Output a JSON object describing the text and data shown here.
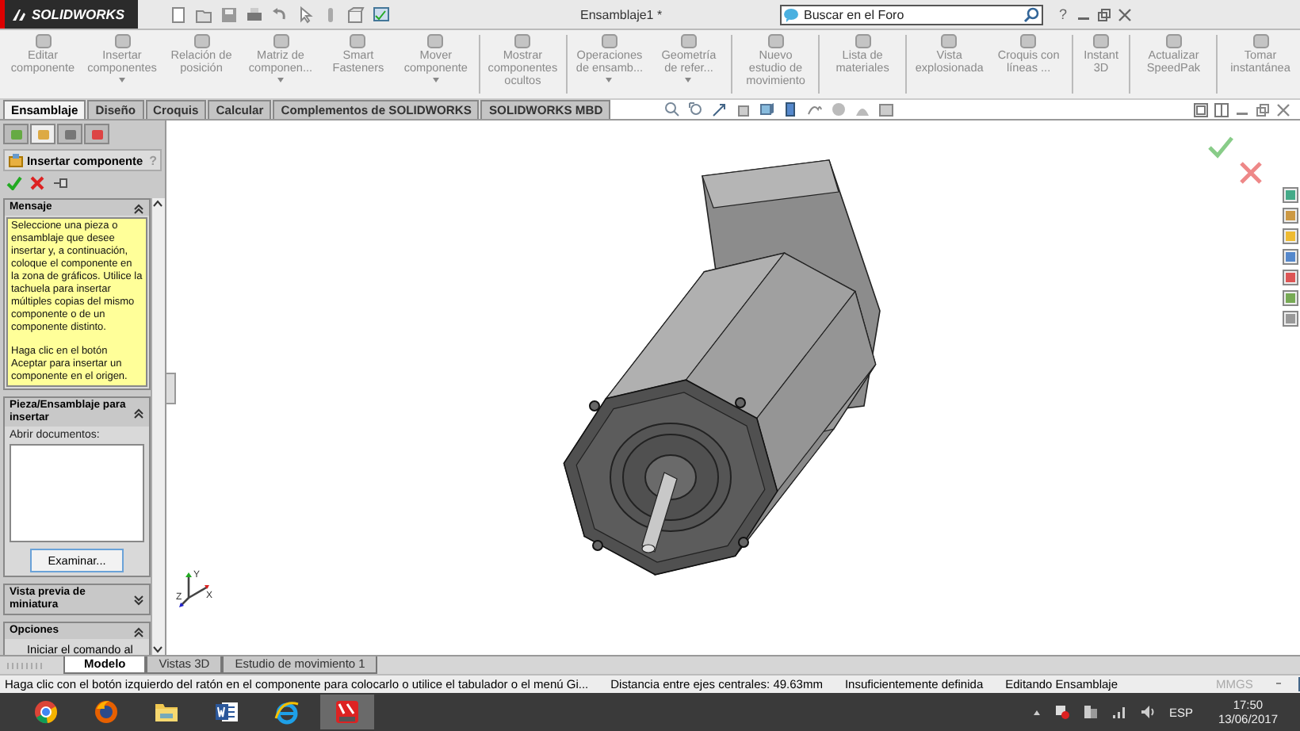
{
  "app": {
    "logo_text": "SOLIDWORKS",
    "document_title": "Ensamblaje1 *",
    "search": {
      "placeholder": "Buscar en el Foro"
    },
    "help": "?"
  },
  "ribbon": [
    {
      "label": "Editar componente",
      "disabled": true,
      "dropdown": false,
      "group_end": false
    },
    {
      "label": "Insertar componentes",
      "disabled": true,
      "dropdown": true,
      "group_end": false
    },
    {
      "label": "Relación de posición",
      "disabled": true,
      "dropdown": false,
      "group_end": false
    },
    {
      "label": "Matriz de componen...",
      "disabled": true,
      "dropdown": true,
      "group_end": false
    },
    {
      "label": "Smart Fasteners",
      "disabled": true,
      "dropdown": false,
      "group_end": false
    },
    {
      "label": "Mover componente",
      "disabled": true,
      "dropdown": true,
      "group_end": true
    },
    {
      "label": "Mostrar componentes ocultos",
      "disabled": true,
      "dropdown": false,
      "group_end": true
    },
    {
      "label": "Operaciones de ensamb...",
      "disabled": true,
      "dropdown": true,
      "group_end": false
    },
    {
      "label": "Geometría de refer...",
      "disabled": true,
      "dropdown": true,
      "group_end": true
    },
    {
      "label": "Nuevo estudio de movimiento",
      "disabled": true,
      "dropdown": false,
      "group_end": true
    },
    {
      "label": "Lista de materiales",
      "disabled": true,
      "dropdown": false,
      "group_end": true
    },
    {
      "label": "Vista explosionada",
      "disabled": true,
      "dropdown": false,
      "group_end": false
    },
    {
      "label": "Croquis con líneas ...",
      "disabled": true,
      "dropdown": false,
      "group_end": true
    },
    {
      "label": "Instant 3D",
      "disabled": true,
      "dropdown": false,
      "group_end": true
    },
    {
      "label": "Actualizar SpeedPak",
      "disabled": true,
      "dropdown": false,
      "group_end": true
    },
    {
      "label": "Tomar instantánea",
      "disabled": true,
      "dropdown": false,
      "group_end": false
    }
  ],
  "command_tabs": [
    {
      "label": "Ensamblaje",
      "selected": true
    },
    {
      "label": "Diseño",
      "selected": false
    },
    {
      "label": "Croquis",
      "selected": false
    },
    {
      "label": "Calcular",
      "selected": false
    },
    {
      "label": "Complementos de SOLIDWORKS",
      "selected": false
    },
    {
      "label": "SOLIDWORKS MBD",
      "selected": false
    }
  ],
  "property_manager": {
    "panel_tabs": [
      {
        "selected": false
      },
      {
        "selected": true
      },
      {
        "selected": false
      },
      {
        "selected": false
      }
    ],
    "title": "Insertar componente",
    "help": "?",
    "sections": [
      {
        "kind": "message",
        "title": "Mensaje",
        "expanded": true,
        "paragraphs": [
          "Seleccione una pieza o ensamblaje que desee insertar y, a continuación, coloque el componente en la zona de gráficos. Utilice la tachuela para insertar múltiples copias del mismo componente o de un componente distinto.",
          "Haga clic en el botón Aceptar para insertar un componente en el origen."
        ]
      },
      {
        "kind": "documents",
        "title": "Pieza/Ensamblaje para insertar",
        "expanded": true,
        "label": "Abrir documentos:",
        "button": "Examinar..."
      },
      {
        "kind": "plain",
        "title": "Vista previa de miniatura",
        "expanded": false
      },
      {
        "kind": "options",
        "title": "Opciones",
        "expanded": true,
        "text": "Iniciar el comando al"
      }
    ]
  },
  "triad": {
    "labels": [
      "Y",
      "X",
      "Z"
    ]
  },
  "bottom_tabs": [
    {
      "label": "Modelo",
      "selected": true
    },
    {
      "label": "Vistas 3D",
      "selected": false
    },
    {
      "label": "Estudio de movimiento 1",
      "selected": false
    }
  ],
  "status_bar": {
    "hint": "Haga clic con el botón izquierdo del ratón en el componente para colocarlo o utilice el tabulador o el menú Gi...",
    "distance": "Distancia entre ejes centrales: 49.63mm",
    "definition": "Insuficientemente definida",
    "mode": "Editando Ensamblaje",
    "units": "MMGS"
  },
  "taskbar": {
    "apps": [
      {
        "kind": "chrome",
        "selected": false
      },
      {
        "kind": "firefox",
        "selected": false
      },
      {
        "kind": "explorer",
        "selected": false
      },
      {
        "kind": "word",
        "selected": false
      },
      {
        "kind": "ie",
        "selected": false
      },
      {
        "kind": "solidworks",
        "selected": true
      }
    ],
    "language": "ESP",
    "time": "17:50",
    "date": "13/06/2017"
  }
}
